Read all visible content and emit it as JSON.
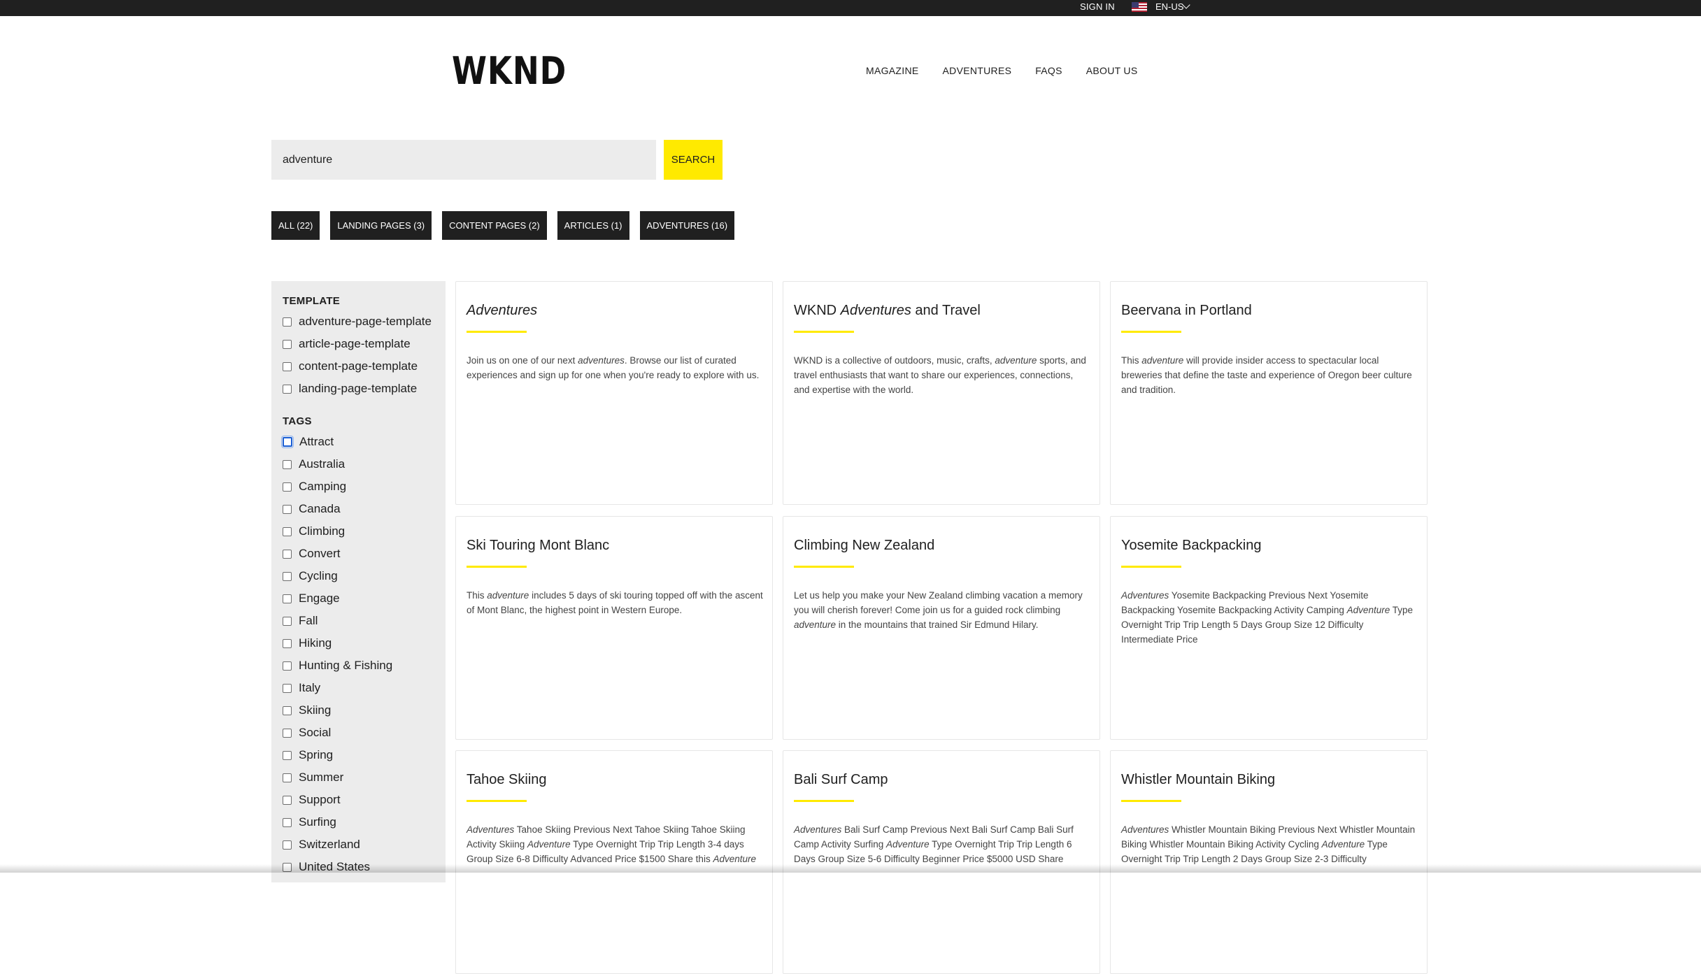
{
  "topbar": {
    "sign_in": "SIGN IN",
    "language": "EN-US"
  },
  "header": {
    "logo": "WKND",
    "nav": [
      "MAGAZINE",
      "ADVENTURES",
      "FAQS",
      "ABOUT US"
    ]
  },
  "search": {
    "value": "adventure",
    "button_label": "SEARCH"
  },
  "filters": [
    "ALL (22)",
    "LANDING PAGES (3)",
    "CONTENT PAGES (2)",
    "ARTICLES (1)",
    "ADVENTURES (16)"
  ],
  "sidebar": {
    "template_heading": "TEMPLATE",
    "templates": [
      "adventure-page-template",
      "article-page-template",
      "content-page-template",
      "landing-page-template"
    ],
    "tags_heading": "TAGS",
    "tags": [
      "Attract",
      "Australia",
      "Camping",
      "Canada",
      "Climbing",
      "Convert",
      "Cycling",
      "Engage",
      "Fall",
      "Hiking",
      "Hunting & Fishing",
      "Italy",
      "Skiing",
      "Social",
      "Spring",
      "Summer",
      "Support",
      "Surfing",
      "Switzerland",
      "United States"
    ]
  },
  "results": [
    {
      "title_html": "<em>Adventures</em>",
      "desc_html": "Join us on one of our next <em>adventures</em>. Browse our list of curated experiences and sign up for one when you're ready to explore with us."
    },
    {
      "title_html": "WKND <em>Adventures</em> and Travel",
      "desc_html": "WKND is a collective of outdoors, music, crafts, <em>adventure</em> sports, and travel enthusiasts that want to share our experiences, connections, and expertise with the world."
    },
    {
      "title_html": "Beervana in Portland",
      "desc_html": "This <em>adventure</em> will provide insider access to spectacular local breweries that define the taste and experience of Oregon beer culture and tradition."
    },
    {
      "title_html": "Ski Touring Mont Blanc",
      "desc_html": "This <em>adventure</em> includes 5 days of ski touring topped off with the ascent of Mont Blanc, the highest point in Western Europe."
    },
    {
      "title_html": "Climbing New Zealand",
      "desc_html": "Let us help you make your New Zealand climbing vacation a memory you will cherish forever! Come join us for a guided rock climbing <em>adventure</em> in the mountains that trained Sir Edmund Hilary."
    },
    {
      "title_html": "Yosemite Backpacking",
      "desc_html": "<em>Adventures</em> Yosemite Backpacking Previous Next Yosemite Backpacking Yosemite Backpacking Activity Camping <em>Adventure</em> Type Overnight Trip Trip Length 5 Days Group Size 12 Difficulty Intermediate Price"
    },
    {
      "title_html": "Tahoe Skiing",
      "desc_html": "<em>Adventures</em> Tahoe Skiing Previous Next Tahoe Skiing Tahoe Skiing Activity Skiing <em>Adventure</em> Type Overnight Trip Trip Length 3-4 days Group Size 6-8 Difficulty Advanced Price $1500 Share this <em>Adventure</em>"
    },
    {
      "title_html": "Bali Surf Camp",
      "desc_html": "<em>Adventures</em> Bali Surf Camp Previous Next Bali Surf Camp Bali Surf Camp Activity Surfing <em>Adventure</em> Type Overnight Trip Trip Length 6 Days Group Size 5-6 Difficulty Beginner Price $5000 USD Share"
    },
    {
      "title_html": "Whistler Mountain Biking",
      "desc_html": "<em>Adventures</em> Whistler Mountain Biking Previous Next Whistler Mountain Biking Whistler Mountain Biking Activity Cycling <em>Adventure</em> Type Overnight Trip Trip Length 2 Days Group Size 2-3 Difficulty"
    }
  ]
}
